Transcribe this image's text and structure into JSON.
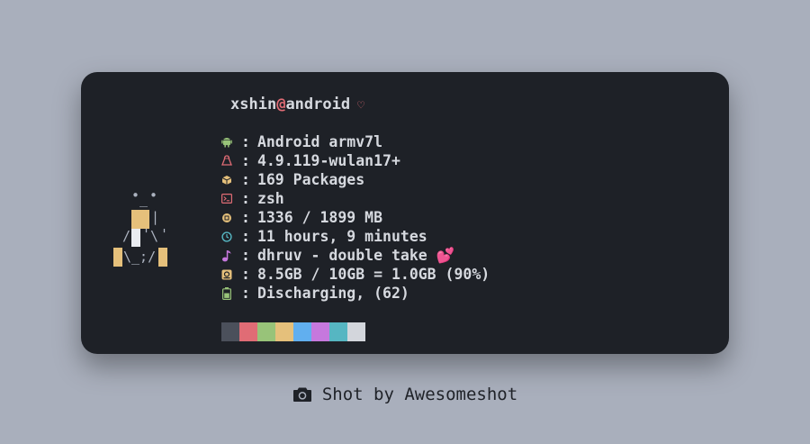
{
  "colors": {
    "page_background": "#a9afbc",
    "terminal_background": "#1e2127",
    "text": "#d6d9df",
    "at_sign": "#e06c75",
    "heart": "#e06c75"
  },
  "header": {
    "user": "xshin",
    "at": "@",
    "host": "android",
    "heart": "♡"
  },
  "info_rows": [
    {
      "icon": "android-icon",
      "color": "#98c379",
      "separator": ":",
      "value": "Android armv7l"
    },
    {
      "icon": "linux-tux-icon",
      "color": "#e06c75",
      "separator": ":",
      "value": "4.9.119-wulan17+"
    },
    {
      "icon": "package-box-icon",
      "color": "#e5c07b",
      "separator": ":",
      "value": "169 Packages"
    },
    {
      "icon": "terminal-shell-icon",
      "color": "#e06c75",
      "separator": ":",
      "value": "zsh"
    },
    {
      "icon": "memory-chip-icon",
      "color": "#e5c07b",
      "separator": ":",
      "value": "1336 / 1899 MB"
    },
    {
      "icon": "clock-icon",
      "color": "#56b6c2",
      "separator": ":",
      "value": "11 hours, 9 minutes"
    },
    {
      "icon": "music-note-icon",
      "color": "#c678dd",
      "separator": ":",
      "value": "dhruv - double take 💕"
    },
    {
      "icon": "storage-disk-icon",
      "color": "#e5c07b",
      "separator": ":",
      "value": "8.5GB / 10GB = 1.0GB (90%)"
    },
    {
      "icon": "battery-icon",
      "color": "#98c379",
      "separator": ":",
      "value": "Discharging, (62)"
    }
  ],
  "palette": [
    "#4b505b",
    "#e06c75",
    "#98c379",
    "#e5c07b",
    "#61afef",
    "#c678dd",
    "#56b6c2",
    "#d3d6dc"
  ],
  "footer": {
    "icon": "camera-icon",
    "text": "Shot by Awesomeshot"
  }
}
